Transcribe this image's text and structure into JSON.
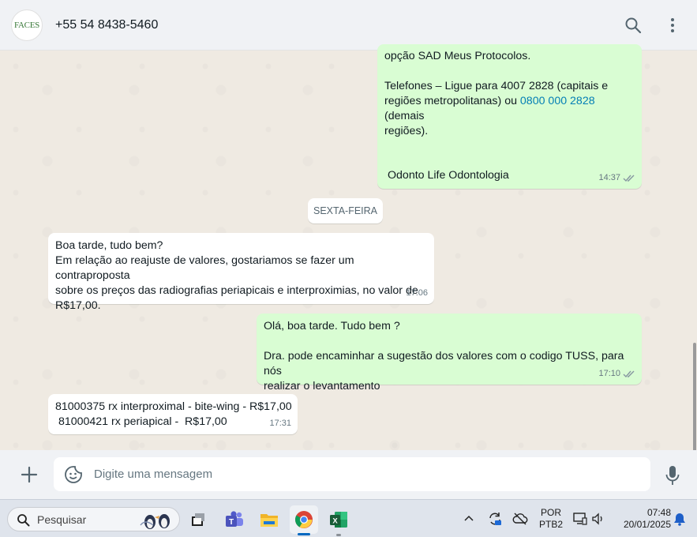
{
  "header": {
    "avatar_text": "FACES",
    "contact_name": "+55 54 8438-5460",
    "search_icon": "search-icon",
    "menu_icon": "kebab-menu-icon"
  },
  "messages": [
    {
      "direction": "outgoing",
      "line1": "opção SAD Meus Protocolos.",
      "phones_a": "Telefones – Ligue para 4007 2828 (capitais e\nregiões metropolitanas) ou ",
      "phones_link": "0800 000 2828",
      "phones_b": " (demais\nregiões).",
      "signature": "Odonto Life Odontologia",
      "time": "14:37"
    },
    {
      "direction": "incoming",
      "text": "Boa tarde, tudo bem?\nEm relação ao reajuste de valores, gostariamos se fazer um contraproposta\nsobre os preços das radiografias periapicais e interproximias, no valor de\nR$17,00.",
      "time": "17:06"
    },
    {
      "direction": "outgoing",
      "text": "Olá, boa tarde. Tudo bem ?\n\nDra. pode encaminhar a sugestão dos valores com o codigo TUSS, para nós\nrealizar o levantamento",
      "time": "17:10"
    },
    {
      "direction": "incoming",
      "text": "81000375 rx interproximal - bite-wing - R$17,00\n 81000421 rx periapical -  R$17,00",
      "time": "17:31"
    }
  ],
  "day_separator": "SEXTA-FEIRA",
  "composer": {
    "placeholder": "Digite uma mensagem",
    "attach_icon": "plus-icon",
    "sticker_icon": "sticker-icon",
    "mic_icon": "microphone-icon"
  },
  "taskbar": {
    "search_placeholder": "Pesquisar",
    "language": "POR",
    "keyboard": "PTB2",
    "time": "07:48",
    "date": "20/01/2025",
    "apps": [
      "task-view-icon",
      "teams-icon",
      "file-explorer-icon",
      "chrome-icon",
      "excel-icon"
    ]
  },
  "colors": {
    "outgoing_bubble": "#d9fdd3",
    "incoming_bubble": "#ffffff",
    "chat_background": "#efeae2",
    "header_background": "#f0f2f5",
    "link": "#027eb5",
    "taskbar_background": "#dfe4ec"
  }
}
